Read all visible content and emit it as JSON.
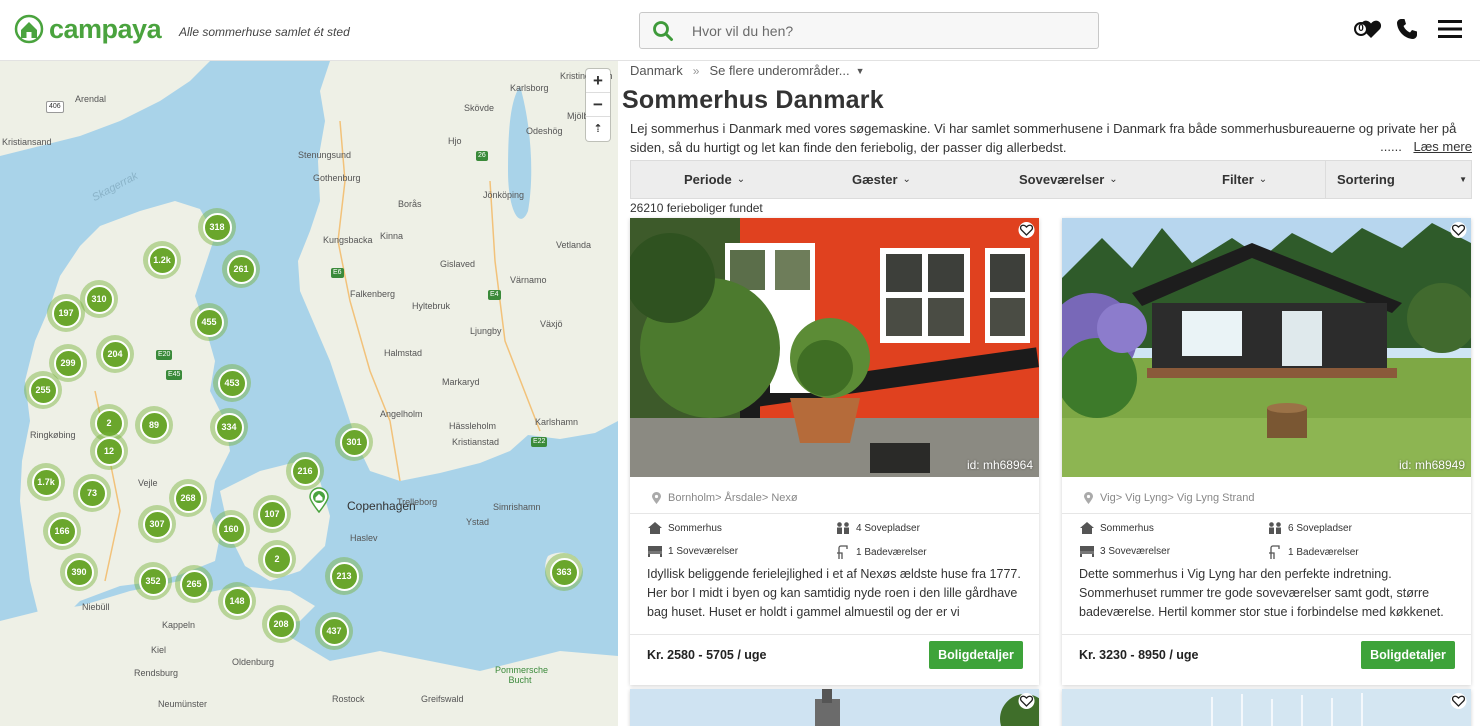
{
  "header": {
    "brand": "campaya",
    "tagline": "Alle sommerhuse samlet ét sted",
    "search_placeholder": "Hvor vil du hen?",
    "favorites_count": "0"
  },
  "map": {
    "zoom_in": "+",
    "zoom_out": "−",
    "reset": "⇡",
    "places": [
      "Arendal",
      "Kristiansand",
      "Skagerrak",
      "Karlsborg",
      "Kristinehamn",
      "Skövde",
      "Odeshög",
      "Mjölby",
      "Hjo",
      "Stenungsund",
      "Gothenburg",
      "Borås",
      "Jönköping",
      "Kungsbacka",
      "Kinna",
      "Vetlanda",
      "Gislaved",
      "Värnamo",
      "Falkenberg",
      "Hyltebruk",
      "Ljungby",
      "Växjö",
      "Halmstad",
      "Markaryd",
      "Angelholm",
      "Hässleholm",
      "Karlshamn",
      "Kristianstad",
      "Ringkøbing",
      "Vejle",
      "Copenhagen",
      "Trelleborg",
      "Ystad",
      "Simrishamn",
      "Haslev",
      "Niebüll",
      "Kappeln",
      "Kiel",
      "Oldenburg",
      "Rendsburg",
      "Neumünster",
      "Rostock",
      "Greifswald",
      "Pommersche Bucht"
    ],
    "roads": [
      "406",
      "E6",
      "E20",
      "E45",
      "E4",
      "E22",
      "26",
      "E45"
    ],
    "clusters": [
      "318",
      "1.2k",
      "261",
      "310",
      "197",
      "455",
      "204",
      "299",
      "453",
      "255",
      "2",
      "89",
      "334",
      "12",
      "301",
      "1.7k",
      "216",
      "73",
      "268",
      "166",
      "307",
      "160",
      "107",
      "390",
      "2",
      "352",
      "265",
      "213",
      "148",
      "363",
      "208",
      "437"
    ]
  },
  "breadcrumb": {
    "root": "Danmark",
    "separator": "»",
    "more": "Se flere underområder...",
    "caret": "▼"
  },
  "page": {
    "title": "Sommerhus Danmark",
    "intro": "Lej sommerhus i Danmark med vores søgemaskine. Vi har samlet sommerhusene i Danmark fra både sommerhusbureauerne og private her på siden, så du hurtigt og let kan finde den feriebolig, der passer dig allerbedst.",
    "ellipsis": "......",
    "read_more": "Læs mere",
    "results": "26210 ferieboliger fundet"
  },
  "filters": {
    "period": "Periode",
    "guests": "Gæster",
    "bedrooms": "Soveværelser",
    "filter": "Filter",
    "sorting": "Sortering",
    "chevron": "⌄",
    "sort_arrow": "▼"
  },
  "listings": [
    {
      "id": "id: mh68964",
      "location": "Bornholm> Årsdale> Nexø",
      "type": "Sommerhus",
      "sleeps": "4 Sovepladser",
      "bedrooms": "1 Soveværelser",
      "bathrooms": "1 Badeværelser",
      "description": "Idyllisk beliggende ferielejlighed i et af Nexøs ældste huse fra 1777. Her bor I midt i byen og kan samtidig nyde roen i den lille gårdhave bag huset. Huset er holdt i gammel almuestil og der er vi",
      "price": "Kr. 2580 - 5705 / uge",
      "button": "Boligdetaljer"
    },
    {
      "id": "id: mh68949",
      "location": "Vig> Vig Lyng> Vig Lyng Strand",
      "type": "Sommerhus",
      "sleeps": "6 Sovepladser",
      "bedrooms": "3 Soveværelser",
      "bathrooms": "1 Badeværelser",
      "description": "Dette sommerhus i Vig Lyng har den perfekte indretning. Sommerhuset rummer tre gode soveværelser samt godt, større badeværelse. Hertil kommer stor stue i forbindelse med køkkenet.",
      "price": "Kr. 3230 - 8950 / uge",
      "button": "Boligdetaljer"
    }
  ],
  "colors": {
    "brand_green": "#4aa33e",
    "button_green": "#3ea33a",
    "cluster_green": "#6aa62c",
    "sea": "#a9d3e9",
    "land": "#eef0e6"
  }
}
